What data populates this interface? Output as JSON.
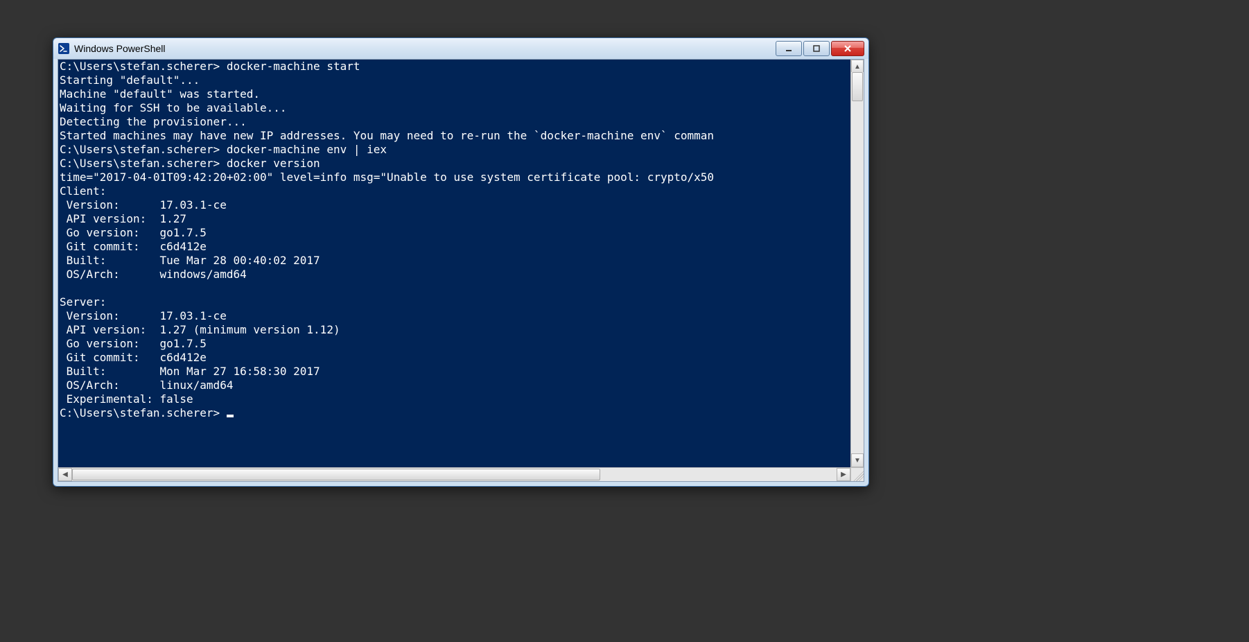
{
  "window": {
    "title": "Windows PowerShell"
  },
  "terminal": {
    "lines": [
      {
        "prompt": "C:\\Users\\stefan.scherer>",
        "command": "docker-machine start"
      },
      {
        "text": "Starting \"default\"..."
      },
      {
        "text": "Machine \"default\" was started."
      },
      {
        "text": "Waiting for SSH to be available..."
      },
      {
        "text": "Detecting the provisioner..."
      },
      {
        "text": "Started machines may have new IP addresses. You may need to re-run the `docker-machine env` comman"
      },
      {
        "prompt": "C:\\Users\\stefan.scherer>",
        "command": "docker-machine env | iex"
      },
      {
        "prompt": "C:\\Users\\stefan.scherer>",
        "command": "docker version"
      },
      {
        "text": "time=\"2017-04-01T09:42:20+02:00\" level=info msg=\"Unable to use system certificate pool: crypto/x50"
      },
      {
        "text": "Client:"
      },
      {
        "text": " Version:      17.03.1-ce"
      },
      {
        "text": " API version:  1.27"
      },
      {
        "text": " Go version:   go1.7.5"
      },
      {
        "text": " Git commit:   c6d412e"
      },
      {
        "text": " Built:        Tue Mar 28 00:40:02 2017"
      },
      {
        "text": " OS/Arch:      windows/amd64"
      },
      {
        "text": ""
      },
      {
        "text": "Server:"
      },
      {
        "text": " Version:      17.03.1-ce"
      },
      {
        "text": " API version:  1.27 (minimum version 1.12)"
      },
      {
        "text": " Go version:   go1.7.5"
      },
      {
        "text": " Git commit:   c6d412e"
      },
      {
        "text": " Built:        Mon Mar 27 16:58:30 2017"
      },
      {
        "text": " OS/Arch:      linux/amd64"
      },
      {
        "text": " Experimental: false"
      },
      {
        "prompt": "C:\\Users\\stefan.scherer>",
        "command": "",
        "cursor": true
      }
    ]
  }
}
